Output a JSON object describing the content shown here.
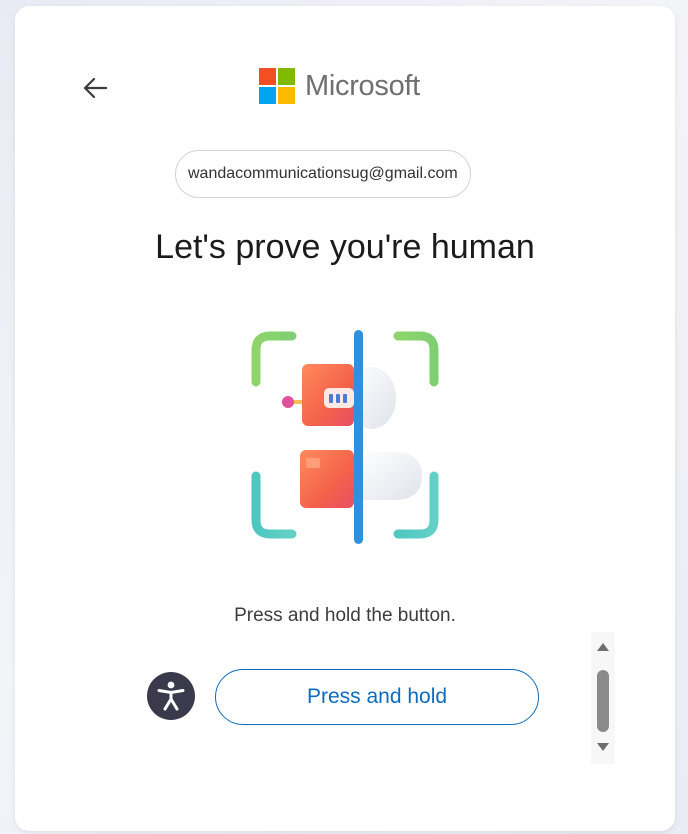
{
  "logo": {
    "text": "Microsoft",
    "colors": [
      "#f25022",
      "#7fba00",
      "#00a4ef",
      "#ffb900"
    ]
  },
  "header": {
    "back_icon": "arrow-left-icon"
  },
  "account": {
    "email": "wandacommunicationsug@gmail.com"
  },
  "main": {
    "title": "Let's prove you're human",
    "illustration_icon": "robot-human-scan-icon",
    "instruction": "Press and hold the button.",
    "press_hold_label": "Press and hold"
  },
  "accessibility": {
    "icon": "accessibility-person-icon"
  },
  "scrollbar": {
    "up_icon": "triangle-up-icon",
    "down_icon": "triangle-down-icon"
  },
  "colors": {
    "accent": "#0f6cbd",
    "accessibility_bg": "#3a3a4c",
    "card_bg": "#ffffff"
  }
}
